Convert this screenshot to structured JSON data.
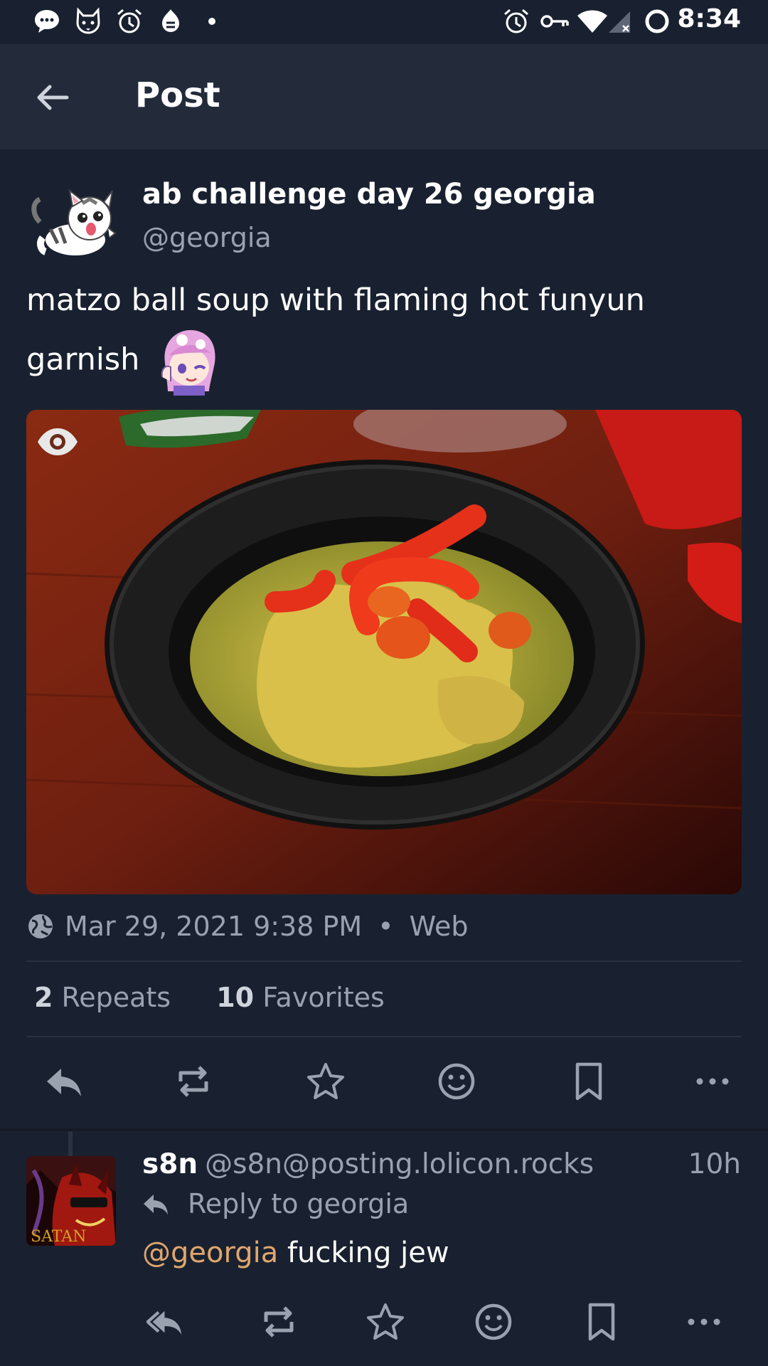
{
  "status_bar": {
    "time": "8:34",
    "left_icons": [
      "chat-bubble-icon",
      "husky-icon",
      "alarm-icon",
      "sync-icon",
      "dot-icon"
    ],
    "right_icons": [
      "alarm-icon",
      "vpn-key-icon",
      "wifi-icon",
      "cell-signal-icon",
      "battery-ring-icon"
    ]
  },
  "app_bar": {
    "title": "Post",
    "back_icon": "arrow-left-icon"
  },
  "post": {
    "author_name": "ab challenge day 26 georgia",
    "author_handle": "@georgia",
    "text": "matzo ball soup with flaming hot funyun garnish",
    "media_visibility_icon": "eye-icon",
    "timestamp": "Mar 29, 2021 9:38 PM",
    "separator": "•",
    "client": "Web",
    "visibility_icon": "globe-icon",
    "repeats_count": "2",
    "repeats_label": "Repeats",
    "favorites_count": "10",
    "favorites_label": "Favorites",
    "actions": [
      "reply-icon",
      "repeat-icon",
      "star-icon",
      "emoji-icon",
      "bookmark-icon",
      "more-icon"
    ]
  },
  "reply": {
    "author_name": "s8n",
    "author_handle": "@s8n@posting.lolicon.rocks",
    "time": "10h",
    "reply_to": "Reply to georgia",
    "mention": "@georgia",
    "text": "fucking jew",
    "avatar_caption": "SATAN",
    "actions": [
      "reply-all-icon",
      "repeat-icon",
      "star-icon",
      "emoji-icon",
      "bookmark-icon",
      "more-icon"
    ]
  },
  "colors": {
    "background": "#192130",
    "app_bar": "#232b3b",
    "muted_text": "#9aa2b0",
    "mention": "#e0a66d"
  }
}
